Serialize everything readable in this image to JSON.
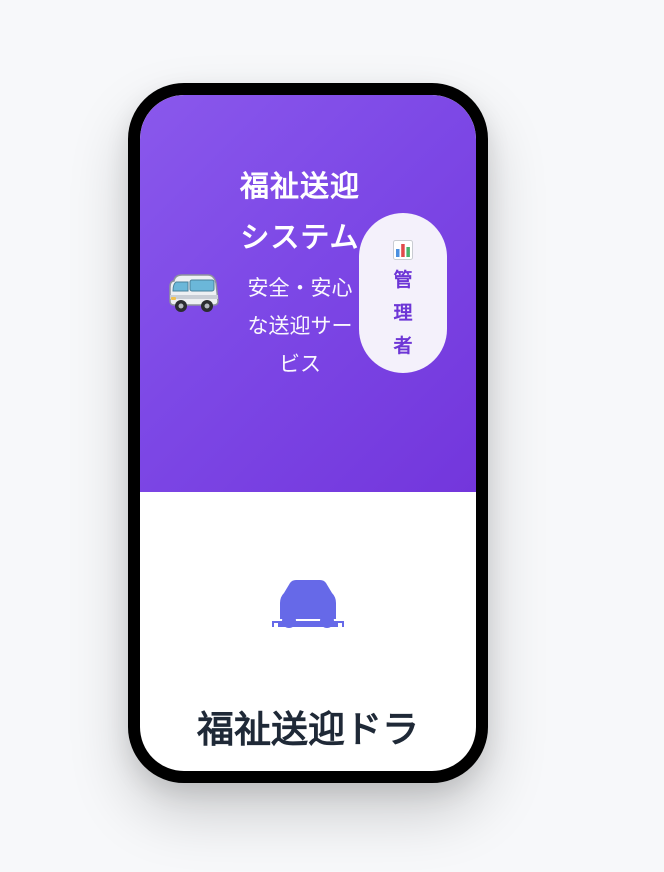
{
  "header": {
    "title": "福祉送迎システム",
    "subtitle": "安全・安心な送迎サービス",
    "van_icon": "van-icon"
  },
  "admin": {
    "icon": "bar-chart-icon",
    "label": "管理者"
  },
  "main": {
    "car_icon": "car-icon",
    "heading": "福祉送迎ドラ"
  },
  "colors": {
    "header_gradient_start": "#8a58ec",
    "header_gradient_end": "#7336dc",
    "accent": "#6d36d6",
    "car": "#6669e8",
    "heading": "#1f2937"
  }
}
